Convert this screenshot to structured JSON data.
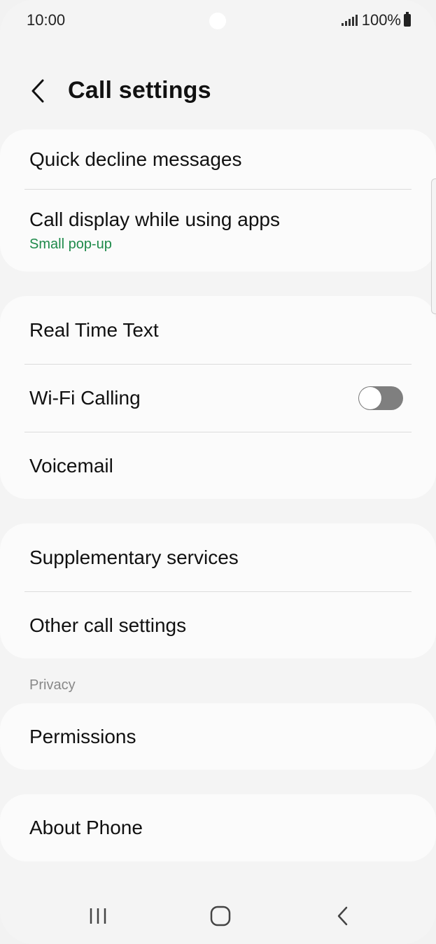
{
  "status_bar": {
    "time": "10:00",
    "battery": "100%"
  },
  "header": {
    "title": "Call settings"
  },
  "group1": {
    "quick_decline": "Quick decline messages",
    "call_display": "Call display while using apps",
    "call_display_value": "Small pop-up"
  },
  "group2": {
    "rtt": "Real Time Text",
    "wifi_calling": "Wi-Fi Calling",
    "wifi_calling_on": false,
    "voicemail": "Voicemail"
  },
  "group3": {
    "supplementary": "Supplementary services",
    "other": "Other call settings"
  },
  "privacy": {
    "section": "Privacy",
    "permissions": "Permissions"
  },
  "about": {
    "label": "About Phone"
  },
  "icons": {
    "back": "chevron-left-icon",
    "recents": "recent-apps-icon",
    "home": "home-icon",
    "nav_back": "nav-back-icon"
  },
  "colors": {
    "accent": "#1e8a4a",
    "toggle_off": "#7f7f7f"
  }
}
